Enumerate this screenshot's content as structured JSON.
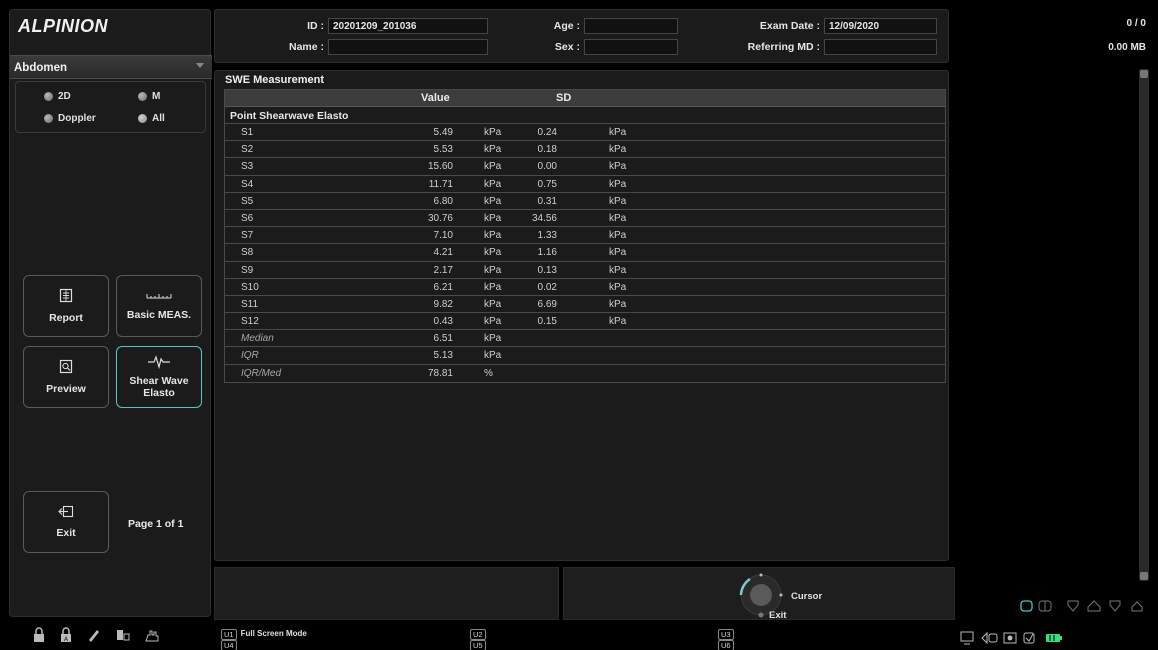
{
  "app": {
    "logo": "ALPINION"
  },
  "sidebar": {
    "preset": "Abdomen",
    "modes": [
      {
        "label": "2D",
        "selected": false
      },
      {
        "label": "M",
        "selected": false
      },
      {
        "label": "Doppler",
        "selected": false
      },
      {
        "label": "All",
        "selected": true
      }
    ],
    "tiles": [
      {
        "label": "Report",
        "icon": "report-icon",
        "active": false
      },
      {
        "label": "Basic MEAS.",
        "icon": "ruler-icon",
        "active": false
      },
      {
        "label": "Preview",
        "icon": "preview-icon",
        "active": false
      },
      {
        "label": "Shear Wave\nElasto",
        "icon": "waveform-icon",
        "active": true
      },
      {
        "label": "Exit",
        "icon": "exit-icon",
        "active": false
      }
    ],
    "page_info": "Page 1 of 1",
    "footer_icons": [
      "lock-icon",
      "lock-a-icon",
      "pen-icon",
      "storage-icon",
      "hand-icon"
    ]
  },
  "patient": {
    "id_label": "ID :",
    "id_value": "20201209_201036",
    "name_label": "Name :",
    "name_value": "",
    "age_label": "Age :",
    "age_value": "",
    "sex_label": "Sex :",
    "sex_value": "",
    "exam_date_label": "Exam Date :",
    "exam_date_value": "12/09/2020",
    "ref_label": "Referring MD :",
    "ref_value": ""
  },
  "status": {
    "count": "0 / 0",
    "storage": "0.00 MB"
  },
  "measurement": {
    "title": "SWE Measurement",
    "col_value": "Value",
    "col_sd": "SD",
    "section": "Point Shearwave Elasto",
    "rows": [
      {
        "name": "S1",
        "value": "5.49",
        "unit": "kPa",
        "sd": "0.24",
        "sd_unit": "kPa"
      },
      {
        "name": "S2",
        "value": "5.53",
        "unit": "kPa",
        "sd": "0.18",
        "sd_unit": "kPa"
      },
      {
        "name": "S3",
        "value": "15.60",
        "unit": "kPa",
        "sd": "0.00",
        "sd_unit": "kPa"
      },
      {
        "name": "S4",
        "value": "11.71",
        "unit": "kPa",
        "sd": "0.75",
        "sd_unit": "kPa"
      },
      {
        "name": "S5",
        "value": "6.80",
        "unit": "kPa",
        "sd": "0.31",
        "sd_unit": "kPa"
      },
      {
        "name": "S6",
        "value": "30.76",
        "unit": "kPa",
        "sd": "34.56",
        "sd_unit": "kPa"
      },
      {
        "name": "S7",
        "value": "7.10",
        "unit": "kPa",
        "sd": "1.33",
        "sd_unit": "kPa"
      },
      {
        "name": "S8",
        "value": "4.21",
        "unit": "kPa",
        "sd": "1.16",
        "sd_unit": "kPa"
      },
      {
        "name": "S9",
        "value": "2.17",
        "unit": "kPa",
        "sd": "0.13",
        "sd_unit": "kPa"
      },
      {
        "name": "S10",
        "value": "6.21",
        "unit": "kPa",
        "sd": "0.02",
        "sd_unit": "kPa"
      },
      {
        "name": "S11",
        "value": "9.82",
        "unit": "kPa",
        "sd": "6.69",
        "sd_unit": "kPa"
      },
      {
        "name": "S12",
        "value": "0.43",
        "unit": "kPa",
        "sd": "0.15",
        "sd_unit": "kPa"
      }
    ],
    "stats": [
      {
        "name": "Median",
        "value": "6.51",
        "unit": "kPa"
      },
      {
        "name": "IQR",
        "value": "5.13",
        "unit": "kPa"
      },
      {
        "name": "IQR/Med",
        "value": "78.81",
        "unit": "%"
      }
    ]
  },
  "control": {
    "cursor_label": "Cursor",
    "exit_label": "Exit"
  },
  "user_keys": [
    {
      "key": "U1",
      "label": "Full Screen Mode"
    },
    {
      "key": "U4",
      "label": ""
    },
    {
      "key": "U2",
      "label": ""
    },
    {
      "key": "U5",
      "label": ""
    },
    {
      "key": "U3",
      "label": ""
    },
    {
      "key": "U6",
      "label": ""
    }
  ],
  "colors": {
    "accent": "#5fc2c2",
    "panel": "#1b1b1b",
    "battery": "#38e07a"
  }
}
